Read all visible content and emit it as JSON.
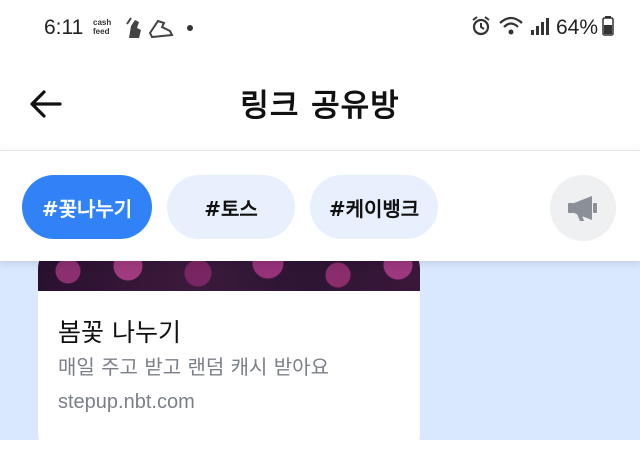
{
  "status_bar": {
    "time": "6:11",
    "cashfeed_line1": "cash",
    "cashfeed_line2": "feed",
    "battery": "64%"
  },
  "header": {
    "title": "링크 공유방"
  },
  "tags": [
    {
      "label": "#꽃나누기",
      "active": true
    },
    {
      "label": "#토스",
      "active": false
    },
    {
      "label": "#케이뱅크",
      "active": false
    }
  ],
  "card": {
    "title": "봄꽃 나누기",
    "description": "매일 주고 받고 랜덤 캐시 받아요",
    "url": "stepup.nbt.com"
  },
  "colors": {
    "accent": "#3182f6",
    "chip_inactive": "#e8f0fd",
    "content_bg": "#d9e8ff"
  },
  "icons": [
    "back-arrow-icon",
    "megaphone-icon",
    "alarm-icon",
    "wifi-icon",
    "signal-icon",
    "battery-icon",
    "shoe-icon"
  ]
}
